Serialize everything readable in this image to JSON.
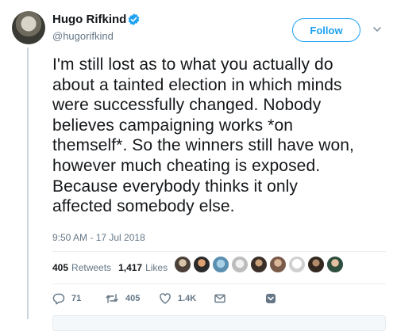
{
  "author": {
    "name": "Hugo Rifkind",
    "handle": "@hugorifkind",
    "verified": true
  },
  "follow_label": "Follow",
  "tweet": {
    "lines": [
      "I'm still lost as to what you actually do",
      "about a tainted election in which minds",
      "were successfully changed. Nobody",
      "believes campaigning works *on",
      "themself*. So the winners still have won,",
      "however much cheating is exposed.",
      "Because everybody thinks it only",
      "affected somebody else."
    ],
    "timestamp": "9:50 AM - 17 Jul 2018"
  },
  "stats": {
    "retweets_count": "405",
    "retweets_label": "Retweets",
    "likes_count": "1,417",
    "likes_label": "Likes"
  },
  "likers_count": 10,
  "actions": {
    "reply_count": "71",
    "retweet_count": "405",
    "like_count": "1.4K"
  },
  "colors": {
    "accent": "#1da1f2",
    "text": "#14171a",
    "secondary": "#657786",
    "divider": "#e6ecf0"
  }
}
